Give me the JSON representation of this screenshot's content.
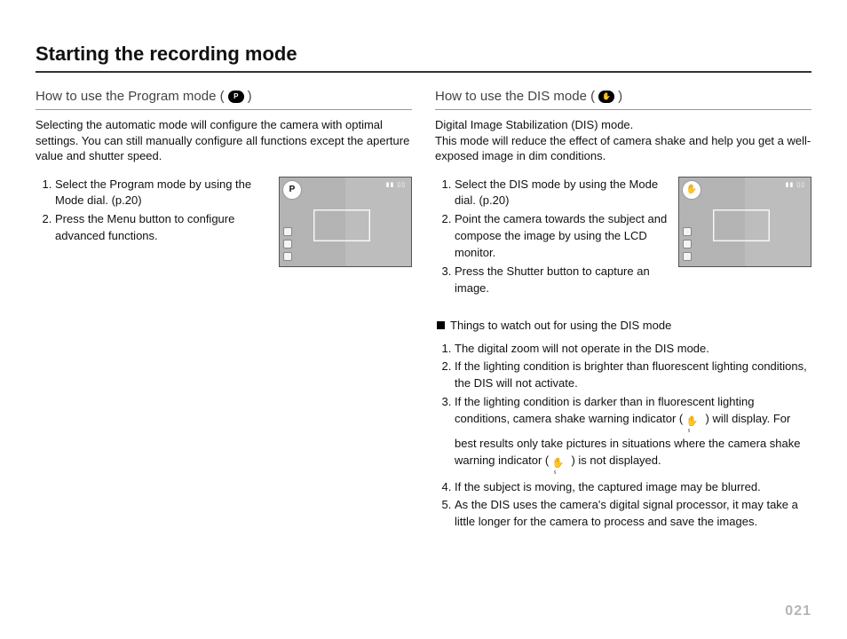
{
  "page": {
    "title": "Starting the recording mode",
    "number": "021"
  },
  "left": {
    "heading_pre": "How to use the Program mode (",
    "heading_post": ")",
    "mode_icon_glyph": "P",
    "mode_icon_name": "program-mode-icon",
    "intro": "Selecting the automatic mode will configure the camera with optimal settings. You can still manually configure all functions except the aperture value and shutter speed.",
    "steps": [
      "Select the Program mode by using the Mode dial. (p.20)",
      "Press the Menu button to configure advanced functions."
    ],
    "lcd_corner_glyph": "P"
  },
  "right": {
    "heading_pre": "How to use the DIS mode (",
    "heading_post": ")",
    "mode_icon_glyph": "✋",
    "mode_icon_name": "dis-mode-icon",
    "intro": "Digital Image Stabilization (DIS) mode.\nThis mode will reduce the effect of camera shake and help you get a well-exposed image in dim conditions.",
    "steps": [
      "Select the DIS mode by using the Mode dial. (p.20)",
      "Point the camera towards the subject and compose the image by using the LCD monitor.",
      "Press the Shutter button to capture an image."
    ],
    "lcd_corner_glyph": "✋",
    "notes_heading": "Things to watch out for using the DIS mode",
    "notes": {
      "n1": "The digital zoom will not operate in the DIS mode.",
      "n2": "If the lighting condition is brighter than fluorescent lighting conditions, the DIS will not activate.",
      "n3a": "If the lighting condition is darker than in fluorescent lighting conditions, camera shake warning indicator (",
      "n3b": ") will display. For best results only take pictures in situations where the camera shake warning indicator (",
      "n3c": ") is not displayed.",
      "n4": "If the subject is moving, the captured image may be blurred.",
      "n5": "As the DIS uses the camera's digital signal processor, it may take a little longer for the camera to process and save the images."
    },
    "shake_icon_glyph": "✋ⸯ"
  }
}
